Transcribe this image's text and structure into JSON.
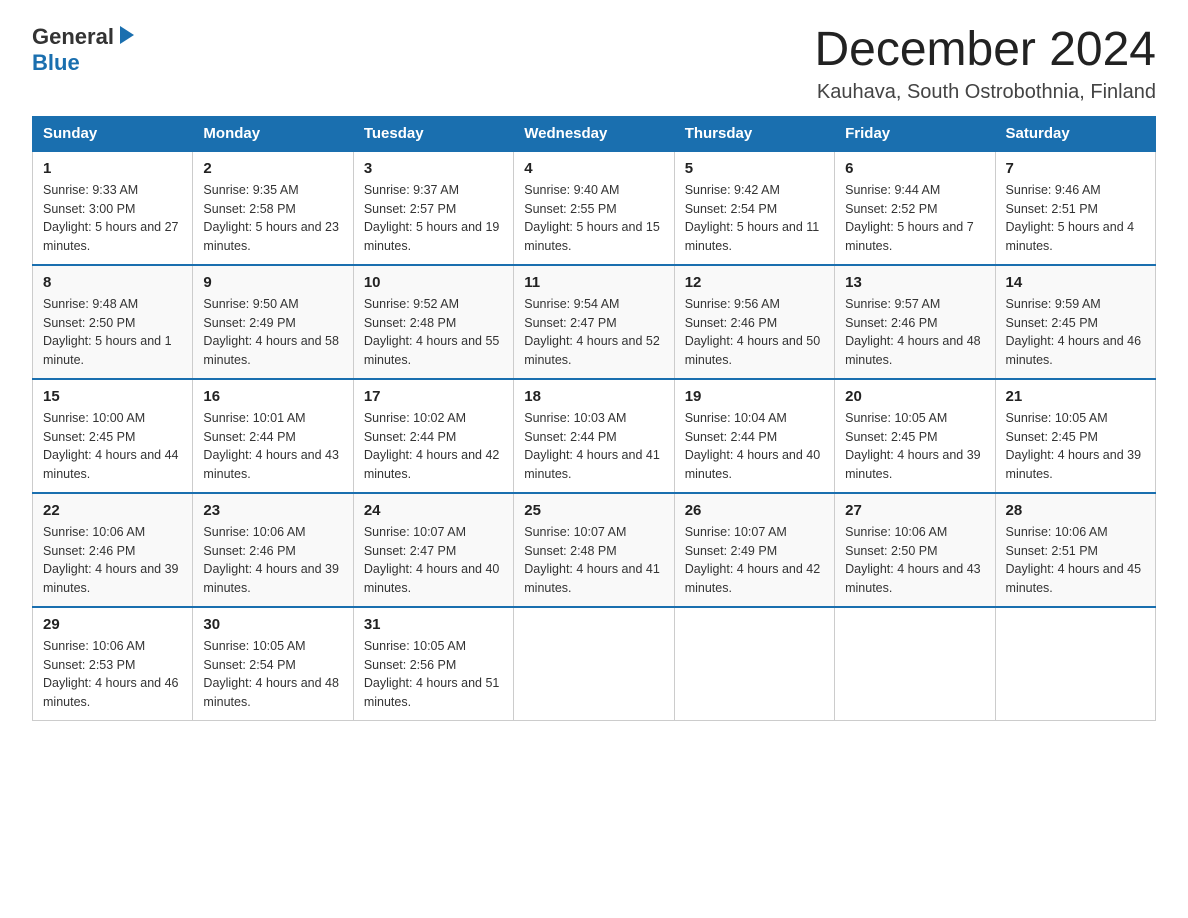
{
  "logo": {
    "line1": "General",
    "line2": "Blue",
    "triangle": "▶"
  },
  "header": {
    "month_title": "December 2024",
    "location": "Kauhava, South Ostrobothnia, Finland"
  },
  "weekdays": [
    "Sunday",
    "Monday",
    "Tuesday",
    "Wednesday",
    "Thursday",
    "Friday",
    "Saturday"
  ],
  "weeks": [
    [
      {
        "day": "1",
        "sunrise": "9:33 AM",
        "sunset": "3:00 PM",
        "daylight": "5 hours and 27 minutes."
      },
      {
        "day": "2",
        "sunrise": "9:35 AM",
        "sunset": "2:58 PM",
        "daylight": "5 hours and 23 minutes."
      },
      {
        "day": "3",
        "sunrise": "9:37 AM",
        "sunset": "2:57 PM",
        "daylight": "5 hours and 19 minutes."
      },
      {
        "day": "4",
        "sunrise": "9:40 AM",
        "sunset": "2:55 PM",
        "daylight": "5 hours and 15 minutes."
      },
      {
        "day": "5",
        "sunrise": "9:42 AM",
        "sunset": "2:54 PM",
        "daylight": "5 hours and 11 minutes."
      },
      {
        "day": "6",
        "sunrise": "9:44 AM",
        "sunset": "2:52 PM",
        "daylight": "5 hours and 7 minutes."
      },
      {
        "day": "7",
        "sunrise": "9:46 AM",
        "sunset": "2:51 PM",
        "daylight": "5 hours and 4 minutes."
      }
    ],
    [
      {
        "day": "8",
        "sunrise": "9:48 AM",
        "sunset": "2:50 PM",
        "daylight": "5 hours and 1 minute."
      },
      {
        "day": "9",
        "sunrise": "9:50 AM",
        "sunset": "2:49 PM",
        "daylight": "4 hours and 58 minutes."
      },
      {
        "day": "10",
        "sunrise": "9:52 AM",
        "sunset": "2:48 PM",
        "daylight": "4 hours and 55 minutes."
      },
      {
        "day": "11",
        "sunrise": "9:54 AM",
        "sunset": "2:47 PM",
        "daylight": "4 hours and 52 minutes."
      },
      {
        "day": "12",
        "sunrise": "9:56 AM",
        "sunset": "2:46 PM",
        "daylight": "4 hours and 50 minutes."
      },
      {
        "day": "13",
        "sunrise": "9:57 AM",
        "sunset": "2:46 PM",
        "daylight": "4 hours and 48 minutes."
      },
      {
        "day": "14",
        "sunrise": "9:59 AM",
        "sunset": "2:45 PM",
        "daylight": "4 hours and 46 minutes."
      }
    ],
    [
      {
        "day": "15",
        "sunrise": "10:00 AM",
        "sunset": "2:45 PM",
        "daylight": "4 hours and 44 minutes."
      },
      {
        "day": "16",
        "sunrise": "10:01 AM",
        "sunset": "2:44 PM",
        "daylight": "4 hours and 43 minutes."
      },
      {
        "day": "17",
        "sunrise": "10:02 AM",
        "sunset": "2:44 PM",
        "daylight": "4 hours and 42 minutes."
      },
      {
        "day": "18",
        "sunrise": "10:03 AM",
        "sunset": "2:44 PM",
        "daylight": "4 hours and 41 minutes."
      },
      {
        "day": "19",
        "sunrise": "10:04 AM",
        "sunset": "2:44 PM",
        "daylight": "4 hours and 40 minutes."
      },
      {
        "day": "20",
        "sunrise": "10:05 AM",
        "sunset": "2:45 PM",
        "daylight": "4 hours and 39 minutes."
      },
      {
        "day": "21",
        "sunrise": "10:05 AM",
        "sunset": "2:45 PM",
        "daylight": "4 hours and 39 minutes."
      }
    ],
    [
      {
        "day": "22",
        "sunrise": "10:06 AM",
        "sunset": "2:46 PM",
        "daylight": "4 hours and 39 minutes."
      },
      {
        "day": "23",
        "sunrise": "10:06 AM",
        "sunset": "2:46 PM",
        "daylight": "4 hours and 39 minutes."
      },
      {
        "day": "24",
        "sunrise": "10:07 AM",
        "sunset": "2:47 PM",
        "daylight": "4 hours and 40 minutes."
      },
      {
        "day": "25",
        "sunrise": "10:07 AM",
        "sunset": "2:48 PM",
        "daylight": "4 hours and 41 minutes."
      },
      {
        "day": "26",
        "sunrise": "10:07 AM",
        "sunset": "2:49 PM",
        "daylight": "4 hours and 42 minutes."
      },
      {
        "day": "27",
        "sunrise": "10:06 AM",
        "sunset": "2:50 PM",
        "daylight": "4 hours and 43 minutes."
      },
      {
        "day": "28",
        "sunrise": "10:06 AM",
        "sunset": "2:51 PM",
        "daylight": "4 hours and 45 minutes."
      }
    ],
    [
      {
        "day": "29",
        "sunrise": "10:06 AM",
        "sunset": "2:53 PM",
        "daylight": "4 hours and 46 minutes."
      },
      {
        "day": "30",
        "sunrise": "10:05 AM",
        "sunset": "2:54 PM",
        "daylight": "4 hours and 48 minutes."
      },
      {
        "day": "31",
        "sunrise": "10:05 AM",
        "sunset": "2:56 PM",
        "daylight": "4 hours and 51 minutes."
      },
      null,
      null,
      null,
      null
    ]
  ]
}
